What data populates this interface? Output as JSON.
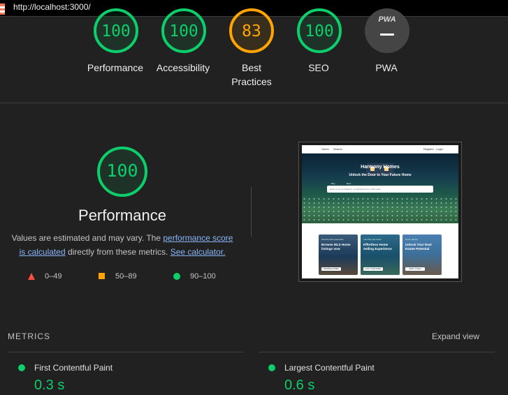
{
  "url_bar": {
    "url": "http://localhost:3000/"
  },
  "scores": [
    {
      "value": "100",
      "label": "Performance",
      "color": "#0cce6b"
    },
    {
      "value": "100",
      "label": "Accessibility",
      "color": "#0cce6b"
    },
    {
      "value": "83",
      "label": "Best Practices",
      "color": "#ffa400"
    },
    {
      "value": "100",
      "label": "SEO",
      "color": "#0cce6b"
    },
    {
      "value": "PWA",
      "label": "PWA",
      "color": "#a0a0a0"
    }
  ],
  "performance": {
    "score": "100",
    "title": "Performance",
    "desc_prefix": "Values are estimated and may vary. The",
    "link_score": "performance score is calculated",
    "desc_middle": "directly from these metrics.",
    "link_calc": "See calculator."
  },
  "legend": [
    {
      "range": "0–49",
      "shape": "triangle",
      "color": "#ff4e42"
    },
    {
      "range": "50–89",
      "shape": "square",
      "color": "#ffa400"
    },
    {
      "range": "90–100",
      "shape": "circle",
      "color": "#0cce6b"
    }
  ],
  "thumbnail": {
    "nav": [
      "Home",
      "Search",
      "Register",
      "Login"
    ],
    "hero_title": "Harmony Homes",
    "hero_subtitle": "Unlock the Door to Your Future Home",
    "tabs": [
      "Buy",
      "Rent"
    ],
    "search_placeholder": "Enter a city, an address, a neighborhood or a ZIP code",
    "cards": [
      {
        "tag": "Find the best properties",
        "title": "Browse MLS Home listings now",
        "button": "BROWSE HOMES"
      },
      {
        "tag": "Let's list your home",
        "title": "Effortless Home Selling Experience",
        "button": "LIST YOUR HOME"
      },
      {
        "tag": "Home ratings",
        "title": "Unlock Your Real Estate Potential",
        "button": "APPLY TODAY"
      }
    ]
  },
  "metrics": {
    "title": "METRICS",
    "expand_label": "Expand view",
    "items": [
      {
        "label": "First Contentful Paint",
        "value": "0.3 s"
      },
      {
        "label": "Largest Contentful Paint",
        "value": "0.6 s"
      }
    ]
  }
}
